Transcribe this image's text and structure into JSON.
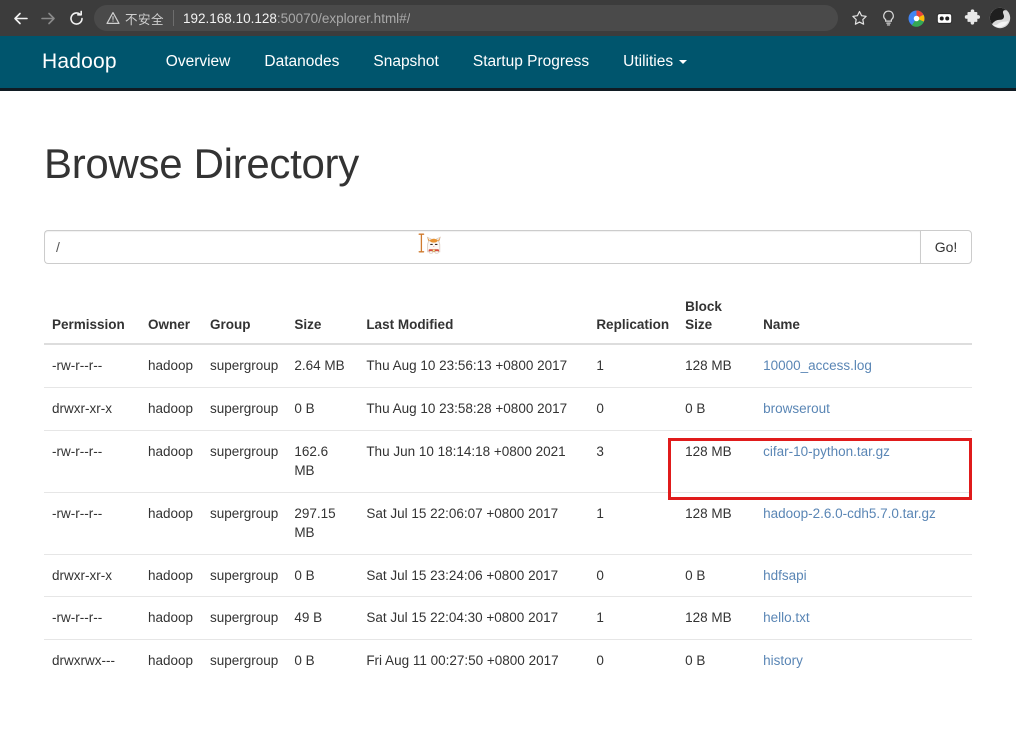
{
  "browser": {
    "back_label": "Back",
    "forward_label": "Forward",
    "reload_label": "Reload",
    "security_label": "不安全",
    "url_host": "192.168.10.128",
    "url_rest": ":50070/explorer.html#/",
    "bookmark_label": "Bookmark this tab",
    "extensions": [
      {
        "name": "lightbulb-icon",
        "label": "Lightbulb extension"
      },
      {
        "name": "color-wheel-icon",
        "label": "Color wheel extension"
      },
      {
        "name": "goggles-icon",
        "label": "Goggles extension"
      },
      {
        "name": "puzzle-icon",
        "label": "Extensions"
      },
      {
        "name": "avatar-icon",
        "label": "Profile"
      }
    ]
  },
  "navbar": {
    "brand": "Hadoop",
    "links": [
      {
        "label": "Overview"
      },
      {
        "label": "Datanodes"
      },
      {
        "label": "Snapshot"
      },
      {
        "label": "Startup Progress"
      },
      {
        "label": "Utilities",
        "has_caret": true
      }
    ],
    "background_color": "#00556d"
  },
  "main": {
    "title": "Browse Directory",
    "path_value": "/",
    "path_placeholder": "",
    "go_label": "Go!"
  },
  "table": {
    "headers": [
      "Permission",
      "Owner",
      "Group",
      "Size",
      "Last Modified",
      "Replication",
      "Block Size",
      "Name"
    ],
    "rows": [
      {
        "permission": "-rw-r--r--",
        "owner": "hadoop",
        "group": "supergroup",
        "size": "2.64 MB",
        "last_modified": "Thu Aug 10 23:56:13 +0800 2017",
        "replication": "1",
        "block_size": "128 MB",
        "name": "10000_access.log"
      },
      {
        "permission": "drwxr-xr-x",
        "owner": "hadoop",
        "group": "supergroup",
        "size": "0 B",
        "last_modified": "Thu Aug 10 23:58:28 +0800 2017",
        "replication": "0",
        "block_size": "0 B",
        "name": "browserout"
      },
      {
        "permission": "-rw-r--r--",
        "owner": "hadoop",
        "group": "supergroup",
        "size": "162.6 MB",
        "last_modified": "Thu Jun 10 18:14:18 +0800 2021",
        "replication": "3",
        "block_size": "128 MB",
        "name": "cifar-10-python.tar.gz"
      },
      {
        "permission": "-rw-r--r--",
        "owner": "hadoop",
        "group": "supergroup",
        "size": "297.15 MB",
        "last_modified": "Sat Jul 15 22:06:07 +0800 2017",
        "replication": "1",
        "block_size": "128 MB",
        "name": "hadoop-2.6.0-cdh5.7.0.tar.gz"
      },
      {
        "permission": "drwxr-xr-x",
        "owner": "hadoop",
        "group": "supergroup",
        "size": "0 B",
        "last_modified": "Sat Jul 15 23:24:06 +0800 2017",
        "replication": "0",
        "block_size": "0 B",
        "name": "hdfsapi"
      },
      {
        "permission": "-rw-r--r--",
        "owner": "hadoop",
        "group": "supergroup",
        "size": "49 B",
        "last_modified": "Sat Jul 15 22:04:30 +0800 2017",
        "replication": "1",
        "block_size": "128 MB",
        "name": "hello.txt"
      },
      {
        "permission": "drwxrwx---",
        "owner": "hadoop",
        "group": "supergroup",
        "size": "0 B",
        "last_modified": "Fri Aug 11 00:27:50 +0800 2017",
        "replication": "0",
        "block_size": "0 B",
        "name": "history"
      }
    ]
  },
  "annotation": {
    "color": "#e01b1b",
    "target_row_name": "cifar-10-python.tar.gz"
  },
  "cursor": {
    "type": "text-cursor-with-cat",
    "colors": {
      "orange": "#e8922f",
      "body": "#f7f5f3",
      "collar": "#d84a3a"
    }
  }
}
